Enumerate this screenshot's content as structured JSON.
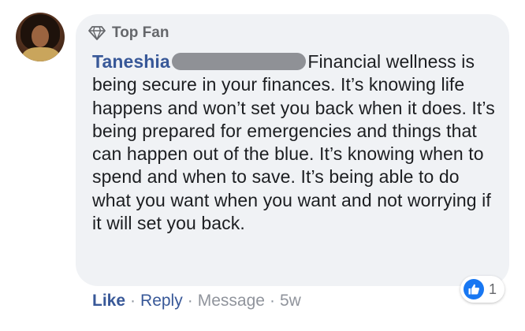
{
  "comment": {
    "badge_label": "Top Fan",
    "author_name": "Taneshia",
    "text": "Financial wellness is being secure in your finances. It’s knowing life happens and won’t set you back when it does. It’s being prepared for emergencies and things that can happen out of the blue. It’s knowing when to spend and when to save. It’s being able to do what you want when you want and not worrying if it will set you back.",
    "reaction_count": "1"
  },
  "actions": {
    "like_label": "Like",
    "reply_label": "Reply",
    "message_label": "Message",
    "time_label": "5w",
    "separator": "·"
  },
  "icons": {
    "badge": "diamond-icon",
    "reaction": "thumbs-up-icon"
  },
  "colors": {
    "link_blue": "#385898",
    "bubble_bg": "#f0f2f5",
    "like_blue": "#1877f2",
    "muted_gray": "#65676b"
  }
}
